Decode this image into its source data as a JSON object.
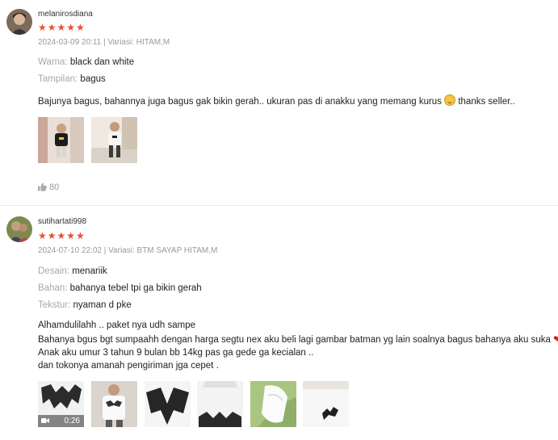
{
  "reviews": [
    {
      "username": "melanirosdiana",
      "stars": "★★★★★",
      "date": "2024-03-09 20:11",
      "variation": "Variasi: HITAM,M",
      "attributes": [
        {
          "label": "Warna:",
          "value": "black dan white"
        },
        {
          "label": "Tampilan:",
          "value": "bagus"
        }
      ],
      "text_before_emoji": "Bajunya bagus, bahannya juga bagus gak bikin gerah.. ukuran pas di anakku yang memang kurus",
      "text_after_emoji": "thanks seller..",
      "likes": "80"
    },
    {
      "username": "sutihartati998",
      "stars": "★★★★★",
      "date": "2024-07-10 22:02",
      "variation": "Variasi: BTM SAYAP HITAM,M",
      "attributes": [
        {
          "label": "Desain:",
          "value": "menariik"
        },
        {
          "label": "Bahan:",
          "value": "bahanya tebel tpi ga bikin gerah"
        },
        {
          "label": "Tekstur:",
          "value": "nyaman d pke"
        }
      ],
      "lines": [
        "Alhamdulilahh .. paket nya udh sampe",
        "Bahanya bgus bgt sumpaahh dengan harga segtu nex aku beli lagi gambar batman yg lain soalnya bagus bahanya aku suka",
        "Anak aku umur 3 tahun 9 bulan bb 14kg pas ga gede ga kecialan ..",
        "dan tokonya amanah pengiriman jga cepet ."
      ],
      "video_duration": "0:26"
    }
  ],
  "icons": {
    "video": "video-camera-icon",
    "like": "thumbs-up-icon",
    "emoji": "grinning-face-icon",
    "heart": "heart-icon"
  },
  "colors": {
    "stars": "#ee4d2d",
    "muted": "#999999"
  }
}
